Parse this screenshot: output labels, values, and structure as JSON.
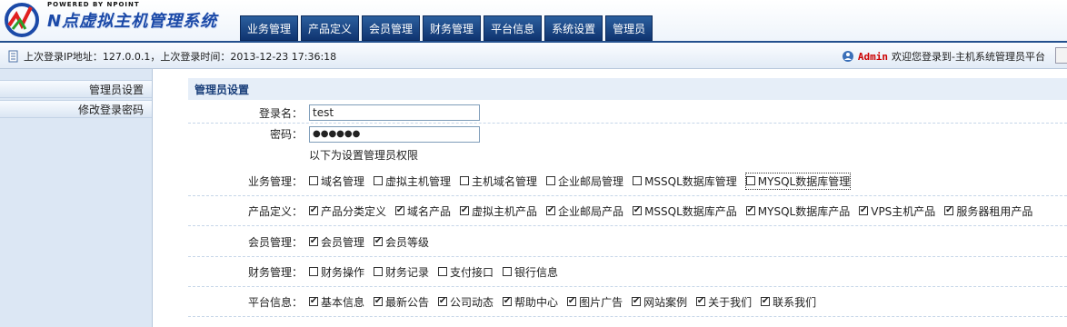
{
  "header": {
    "powered": "POWERED BY NPOINT",
    "brand": "N点虚拟主机管理系统",
    "nav": [
      "业务管理",
      "产品定义",
      "会员管理",
      "财务管理",
      "平台信息",
      "系统设置",
      "管理员"
    ]
  },
  "infobar": {
    "login_info": "上次登录IP地址：127.0.0.1，上次登录时间：2013-12-23 17:36:18",
    "admin": "Admin",
    "welcome": "欢迎您登录到-主机系统管理员平台"
  },
  "sidebar": {
    "items": [
      "管理员设置",
      "修改登录密码"
    ]
  },
  "main": {
    "title": "管理员设置",
    "username_label": "登录名：",
    "username_value": "test",
    "password_label": "密码：",
    "password_value": "●●●●●●",
    "perm_hint": "以下为设置管理员权限",
    "groups": [
      {
        "label": "业务管理：",
        "items": [
          {
            "text": "域名管理",
            "checked": false
          },
          {
            "text": "虚拟主机管理",
            "checked": false
          },
          {
            "text": "主机域名管理",
            "checked": false
          },
          {
            "text": "企业邮局管理",
            "checked": false
          },
          {
            "text": "MSSQL数据库管理",
            "checked": false
          },
          {
            "text": "MYSQL数据库管理",
            "checked": false
          }
        ]
      },
      {
        "label": "产品定义：",
        "items": [
          {
            "text": "产品分类定义",
            "checked": true
          },
          {
            "text": "域名产品",
            "checked": true
          },
          {
            "text": "虚拟主机产品",
            "checked": true
          },
          {
            "text": "企业邮局产品",
            "checked": true
          },
          {
            "text": "MSSQL数据库产品",
            "checked": true
          },
          {
            "text": "MYSQL数据库产品",
            "checked": true
          },
          {
            "text": "VPS主机产品",
            "checked": true
          },
          {
            "text": "服务器租用产品",
            "checked": true
          }
        ]
      },
      {
        "label": "会员管理：",
        "items": [
          {
            "text": "会员管理",
            "checked": true
          },
          {
            "text": "会员等级",
            "checked": true
          }
        ]
      },
      {
        "label": "财务管理：",
        "items": [
          {
            "text": "财务操作",
            "checked": false
          },
          {
            "text": "财务记录",
            "checked": false
          },
          {
            "text": "支付接口",
            "checked": false
          },
          {
            "text": "银行信息",
            "checked": false
          }
        ]
      },
      {
        "label": "平台信息：",
        "items": [
          {
            "text": "基本信息",
            "checked": true
          },
          {
            "text": "最新公告",
            "checked": true
          },
          {
            "text": "公司动态",
            "checked": true
          },
          {
            "text": "帮助中心",
            "checked": true
          },
          {
            "text": "图片广告",
            "checked": true
          },
          {
            "text": "网站案例",
            "checked": true
          },
          {
            "text": "关于我们",
            "checked": true
          },
          {
            "text": "联系我们",
            "checked": true
          }
        ]
      }
    ]
  },
  "colors": {
    "nav_bg": "#1a4683",
    "title_text": "#1a3f7a",
    "admin_red": "#cc0000",
    "sidebar_bg": "#dce7f4"
  }
}
